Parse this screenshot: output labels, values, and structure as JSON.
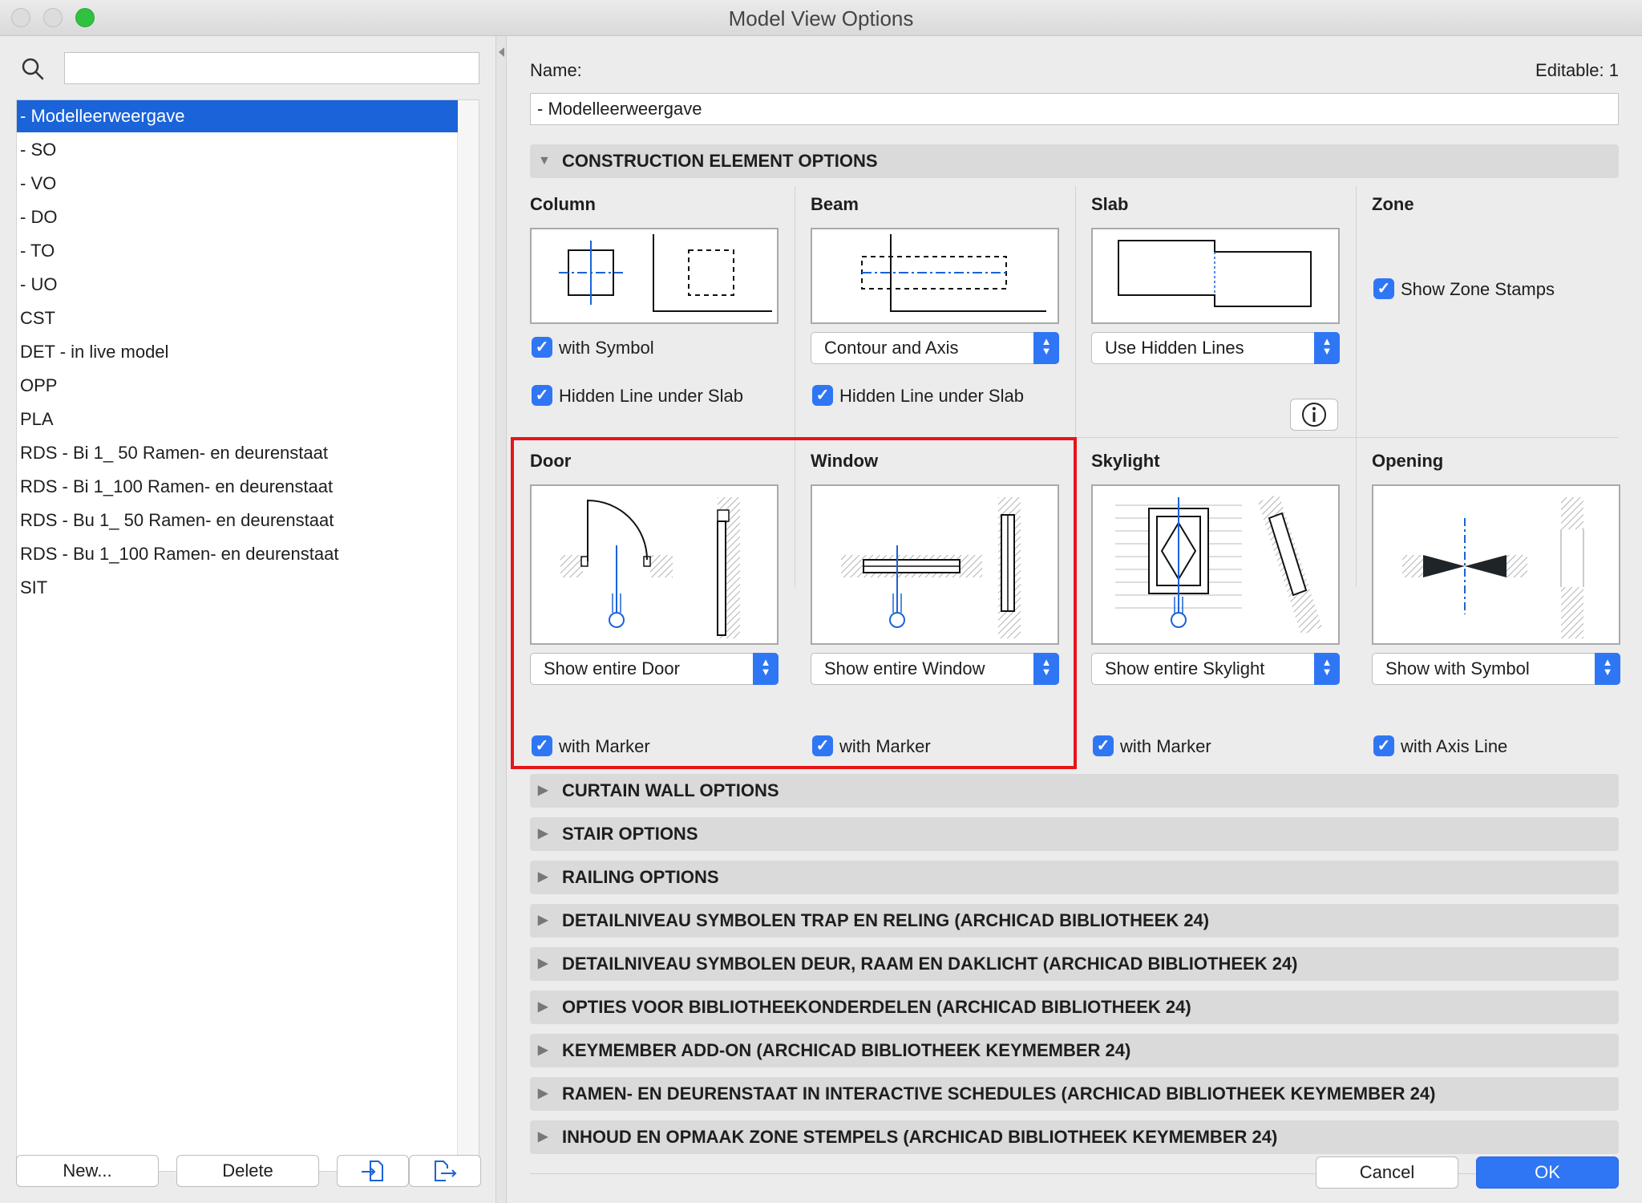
{
  "window": {
    "title": "Model View Options",
    "traffic_lights": {
      "close_color": "#dcdcdc",
      "minimize_color": "#dcdcdc",
      "zoom_color": "#2fc13f"
    }
  },
  "sidebar": {
    "search_placeholder": "",
    "items": [
      {
        "label": "-  Modelleerweergave",
        "selected": true
      },
      {
        "label": "-  SO"
      },
      {
        "label": "-  VO"
      },
      {
        "label": "- DO"
      },
      {
        "label": "- TO"
      },
      {
        "label": "- UO"
      },
      {
        "label": "CST"
      },
      {
        "label": "DET - in live model"
      },
      {
        "label": "OPP"
      },
      {
        "label": "PLA"
      },
      {
        "label": "RDS - Bi 1_ 50 Ramen- en deurenstaat"
      },
      {
        "label": "RDS - Bi 1_100 Ramen- en deurenstaat"
      },
      {
        "label": "RDS - Bu 1_ 50 Ramen- en deurenstaat"
      },
      {
        "label": "RDS - Bu 1_100 Ramen- en deurenstaat"
      },
      {
        "label": "SIT"
      }
    ],
    "new_label": "New...",
    "delete_label": "Delete",
    "import_icon": "import-icon",
    "export_icon": "export-icon",
    "selection_color": "#1a63d9"
  },
  "main": {
    "name_label": "Name:",
    "editable_label": "Editable: 1",
    "name_value": "-  Modelleerweergave",
    "construction_section": "CONSTRUCTION ELEMENT OPTIONS",
    "column": {
      "title": "Column",
      "with_symbol": "with Symbol",
      "hidden_line": "Hidden Line under Slab"
    },
    "beam": {
      "title": "Beam",
      "select": "Contour and Axis",
      "hidden_line": "Hidden Line under Slab"
    },
    "slab": {
      "title": "Slab",
      "select": "Use Hidden Lines"
    },
    "zone": {
      "title": "Zone",
      "show_stamps": "Show Zone Stamps"
    },
    "door": {
      "title": "Door",
      "select": "Show entire Door",
      "marker": "with Marker"
    },
    "window_el": {
      "title": "Window",
      "select": "Show entire Window",
      "marker": "with Marker"
    },
    "skylight": {
      "title": "Skylight",
      "select": "Show entire Skylight",
      "marker": "with Marker"
    },
    "opening": {
      "title": "Opening",
      "select": "Show with Symbol",
      "axis": "with Axis Line"
    },
    "highlight_color": "#e8141b",
    "sections": [
      "CURTAIN WALL OPTIONS",
      "STAIR OPTIONS",
      "RAILING OPTIONS",
      "DETAILNIVEAU SYMBOLEN TRAP EN RELING (ARCHICAD BIBLIOTHEEK 24)",
      "DETAILNIVEAU SYMBOLEN DEUR, RAAM EN DAKLICHT (ARCHICAD BIBLIOTHEEK 24)",
      "OPTIES VOOR BIBLIOTHEEKONDERDELEN (ARCHICAD BIBLIOTHEEK 24)",
      "KEYMEMBER ADD-ON (ARCHICAD BIBLIOTHEEK KEYMEMBER 24)",
      "RAMEN- EN DEURENSTAAT IN INTERACTIVE SCHEDULES (ARCHICAD BIBLIOTHEEK KEYMEMBER 24)",
      "INHOUD EN OPMAAK ZONE STEMPELS (ARCHICAD BIBLIOTHEEK KEYMEMBER 24)"
    ],
    "cancel_label": "Cancel",
    "ok_label": "OK",
    "accent_color": "#2f76f5"
  }
}
